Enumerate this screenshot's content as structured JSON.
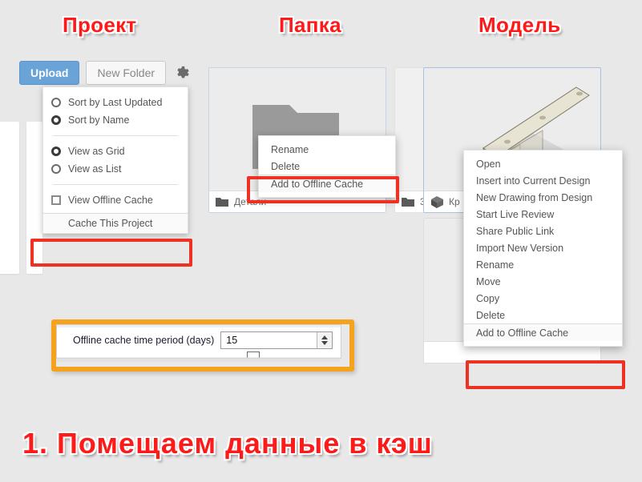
{
  "captions": {
    "project": "Проект",
    "folder": "Папка",
    "model": "Модель",
    "step": "1. Помещаем данные в кэш"
  },
  "colors": {
    "background": "#e8e8e8",
    "upload_button": "#6aa3d8",
    "highlight_red": "#ee3124",
    "highlight_orange": "#f5a21c",
    "card_border_selected": "#a9c2e0"
  },
  "toolbar": {
    "upload_label": "Upload",
    "new_folder_label": "New Folder",
    "settings_icon": "gear-icon"
  },
  "project_menu": {
    "sort_options": [
      {
        "label": "Sort by Last Updated",
        "selected": false
      },
      {
        "label": "Sort by Name",
        "selected": true
      }
    ],
    "view_options": [
      {
        "label": "View as Grid",
        "selected": true
      },
      {
        "label": "View as List",
        "selected": false
      }
    ],
    "offline_checkbox": {
      "label": "View Offline Cache",
      "checked": false
    },
    "cache_action": "Cache This Project"
  },
  "cards": {
    "folder": {
      "label": "Детали",
      "icon": "folder-icon"
    },
    "folder2": {
      "label": "3",
      "icon": "folder-icon"
    },
    "model": {
      "label": "Кр",
      "icon": "cube-icon"
    }
  },
  "folder_context_menu": {
    "items": [
      "Rename",
      "Delete",
      "Add to Offline Cache"
    ],
    "highlighted": "Add to Offline Cache"
  },
  "model_context_menu": {
    "items": [
      "Open",
      "Insert into Current Design",
      "New Drawing from Design",
      "Start Live Review",
      "Share Public Link",
      "Import New Version",
      "Rename",
      "Move",
      "Copy",
      "Delete",
      "Add to Offline Cache"
    ],
    "highlighted": "Add to Offline Cache"
  },
  "settings_dialog": {
    "time_period_label": "Offline cache time period (days)",
    "time_period_value": "15"
  }
}
